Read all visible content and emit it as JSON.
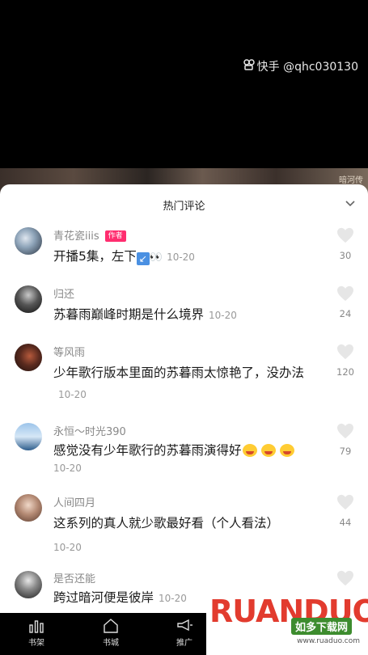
{
  "video": {
    "watermark": "快手 @qhc030130",
    "corner_text": "暗河传"
  },
  "sheet": {
    "title": "热门评论"
  },
  "comments": [
    {
      "user": "青花瓷iiis",
      "author_tag": "作者",
      "text": "开播5集，左下",
      "time": "10-20",
      "likes": "30"
    },
    {
      "user": "归还",
      "text": "苏暮雨巅峰时期是什么境界",
      "time": "10-20",
      "likes": "24"
    },
    {
      "user": "等风雨",
      "text": "少年歌行版本里面的苏暮雨太惊艳了，没办法",
      "time": "10-20",
      "likes": "120"
    },
    {
      "user": "永恒～时光390",
      "text": "感觉没有少年歌行的苏暮雨演得好",
      "time": "10-20",
      "likes": "79"
    },
    {
      "user": "人间四月",
      "text": "这系列的真人就少歌最好看（个人看法）",
      "time": "10-20",
      "likes": "44"
    },
    {
      "user": "是否还能",
      "text": "跨过暗河便是彼岸",
      "time": "10-20",
      "likes": ""
    }
  ],
  "tabbar": {
    "tabs": [
      {
        "label": "书架",
        "icon": "bar-chart-icon"
      },
      {
        "label": "书城",
        "icon": "home-icon"
      },
      {
        "label": "推广",
        "icon": "megaphone-icon"
      }
    ]
  },
  "ad": {
    "brand": "RUANDUO",
    "sub": "如多下载网",
    "url": "www.ruaduo.com"
  }
}
